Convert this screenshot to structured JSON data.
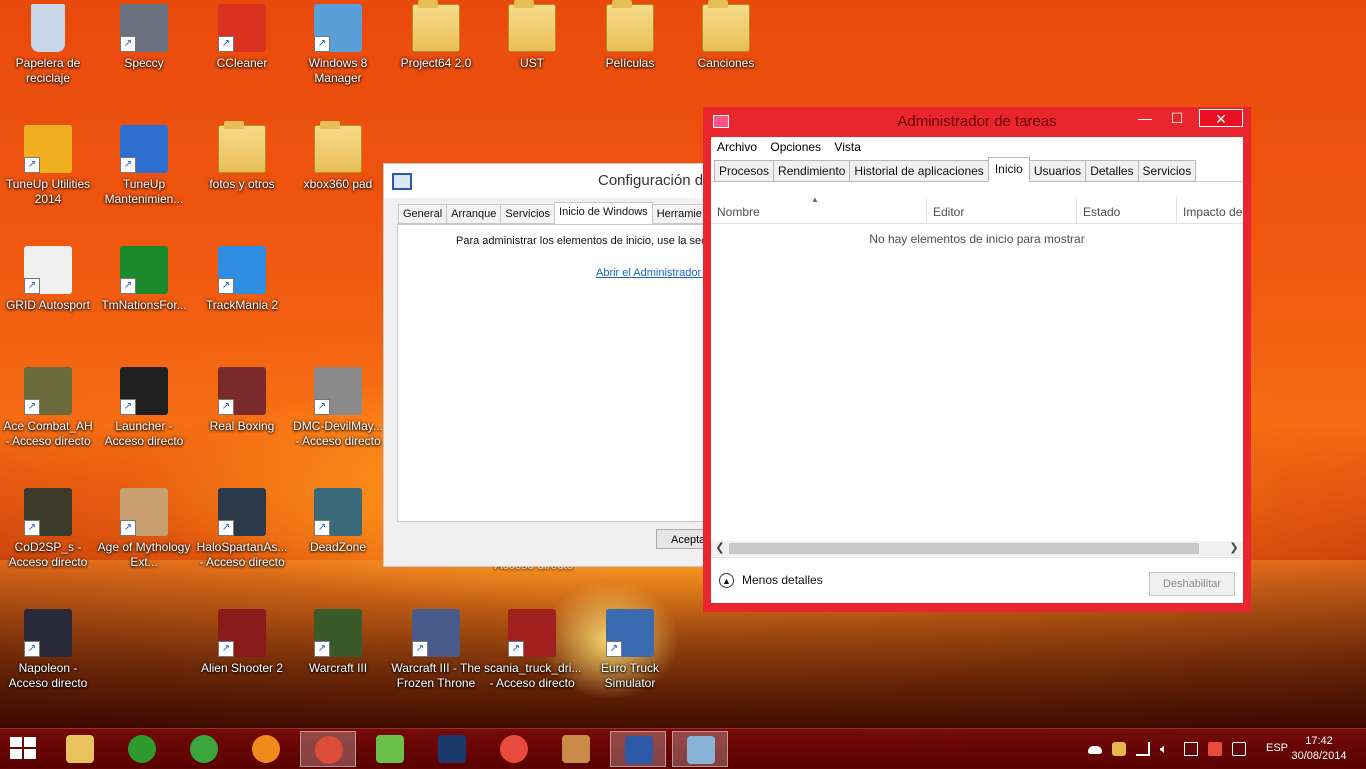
{
  "desktop": {
    "icons": [
      {
        "id": "recycle",
        "label": "Papelera de reciclaje",
        "type": "recycle-bin-icon"
      },
      {
        "id": "speccy",
        "label": "Speccy",
        "type": "speccy-icon"
      },
      {
        "id": "ccleaner",
        "label": "CCleaner",
        "type": "ccleaner-icon"
      },
      {
        "id": "w8m",
        "label": "Windows 8 Manager",
        "type": "windows8-manager-icon"
      },
      {
        "id": "p64",
        "label": "Project64 2.0",
        "type": "folder-icon"
      },
      {
        "id": "ust",
        "label": "UST",
        "type": "folder-icon"
      },
      {
        "id": "peliculas",
        "label": "Películas",
        "type": "folder-icon"
      },
      {
        "id": "canciones",
        "label": "Canciones",
        "type": "folder-icon"
      },
      {
        "id": "tuneup",
        "label": "TuneUp Utilities 2014",
        "type": "tuneup-icon"
      },
      {
        "id": "tuneupm",
        "label": "TuneUp Mantenimien...",
        "type": "tuneup-maintenance-icon"
      },
      {
        "id": "fotos",
        "label": "fotos y otros",
        "type": "folder-icon"
      },
      {
        "id": "xbox",
        "label": "xbox360 pad",
        "type": "folder-icon"
      },
      {
        "id": "grid",
        "label": "GRID Autosport",
        "type": "grid-autosport-icon"
      },
      {
        "id": "tmn",
        "label": "TmNationsFor...",
        "type": "tmnations-icon"
      },
      {
        "id": "tm2",
        "label": "TrackMania 2",
        "type": "trackmania-icon"
      },
      {
        "id": "ace",
        "label": "Ace Combat_AH - Acceso directo",
        "type": "ace-combat-icon"
      },
      {
        "id": "launcher",
        "label": "Launcher - Acceso directo",
        "type": "nfs-launcher-icon"
      },
      {
        "id": "rboxing",
        "label": "Real Boxing",
        "type": "real-boxing-icon"
      },
      {
        "id": "dmc",
        "label": "DMC-DevilMay... - Acceso directo",
        "type": "dmc-icon"
      },
      {
        "id": "cod",
        "label": "CoD2SP_s - Acceso directo",
        "type": "cod2-icon"
      },
      {
        "id": "aom",
        "label": "Age of Mythology Ext...",
        "type": "age-of-mythology-icon"
      },
      {
        "id": "halo",
        "label": "HaloSpartanAs... - Acceso directo",
        "type": "halo-icon"
      },
      {
        "id": "deadzone",
        "label": "DeadZone",
        "type": "deadzone-icon"
      },
      {
        "id": "napoleon",
        "label": "Napoleon - Acceso directo",
        "type": "napoleon-icon"
      },
      {
        "id": "alien",
        "label": "Alien Shooter 2",
        "type": "alien-shooter-icon"
      },
      {
        "id": "wc3",
        "label": "Warcraft III",
        "type": "warcraft3-icon"
      },
      {
        "id": "wc3ft",
        "label": "Warcraft III - The Frozen Throne",
        "type": "frozen-throne-icon"
      },
      {
        "id": "scania",
        "label": "scania_truck_dri... - Acceso directo",
        "type": "scania-truck-icon"
      },
      {
        "id": "ets",
        "label": "Euro Truck Simulator",
        "type": "euro-truck-icon"
      }
    ],
    "hidden_label": "Acceso directo"
  },
  "msconfig": {
    "title": "Configuración d",
    "tabs": [
      "General",
      "Arranque",
      "Servicios",
      "Inicio de Windows",
      "Herramie"
    ],
    "active_tab": "Inicio de Windows",
    "message": "Para administrar los elementos de inicio, use la secc",
    "link": "Abrir el Administrador d",
    "ok_button": "Acepta"
  },
  "taskmgr": {
    "title": "Administrador de tareas",
    "window_buttons": {
      "minimize": "—",
      "maximize": "☐",
      "close": "✕"
    },
    "menu": [
      "Archivo",
      "Opciones",
      "Vista"
    ],
    "tabs": [
      "Procesos",
      "Rendimiento",
      "Historial de aplicaciones",
      "Inicio",
      "Usuarios",
      "Detalles",
      "Servicios"
    ],
    "active_tab": "Inicio",
    "columns": [
      "Nombre",
      "Editor",
      "Estado",
      "Impacto de"
    ],
    "empty_message": "No hay elementos de inicio para mostrar",
    "less_details": "Menos detalles",
    "disable_button": "Deshabilitar"
  },
  "taskbar": {
    "apps": [
      {
        "id": "explorer",
        "icon": "file-explorer-icon",
        "color": "#e8c25a"
      },
      {
        "id": "razer",
        "icon": "razer-game-booster-icon",
        "color": "#2c9a2c"
      },
      {
        "id": "xbox",
        "icon": "xbox-icon",
        "color": "#3aa53a"
      },
      {
        "id": "player",
        "icon": "media-player-icon",
        "color": "#f08a1a"
      },
      {
        "id": "chrome",
        "icon": "chrome-icon",
        "color": "#dd4b39",
        "active": true
      },
      {
        "id": "tool",
        "icon": "green-tool-icon",
        "color": "#6ac04a"
      },
      {
        "id": "ps",
        "icon": "photoshop-icon",
        "color": "#1b3a6b"
      },
      {
        "id": "shutdown",
        "icon": "shutdown-icon",
        "color": "#e84a3c"
      },
      {
        "id": "paint",
        "icon": "paint-icon",
        "color": "#c98a4a"
      },
      {
        "id": "msconfig",
        "icon": "system-config-icon",
        "color": "#2d5aa8",
        "active": true
      },
      {
        "id": "taskmgr",
        "icon": "task-manager-icon",
        "color": "#8ab3d8",
        "active": true
      }
    ],
    "language": "ESP",
    "time": "17:42",
    "date": "30/08/2014"
  }
}
